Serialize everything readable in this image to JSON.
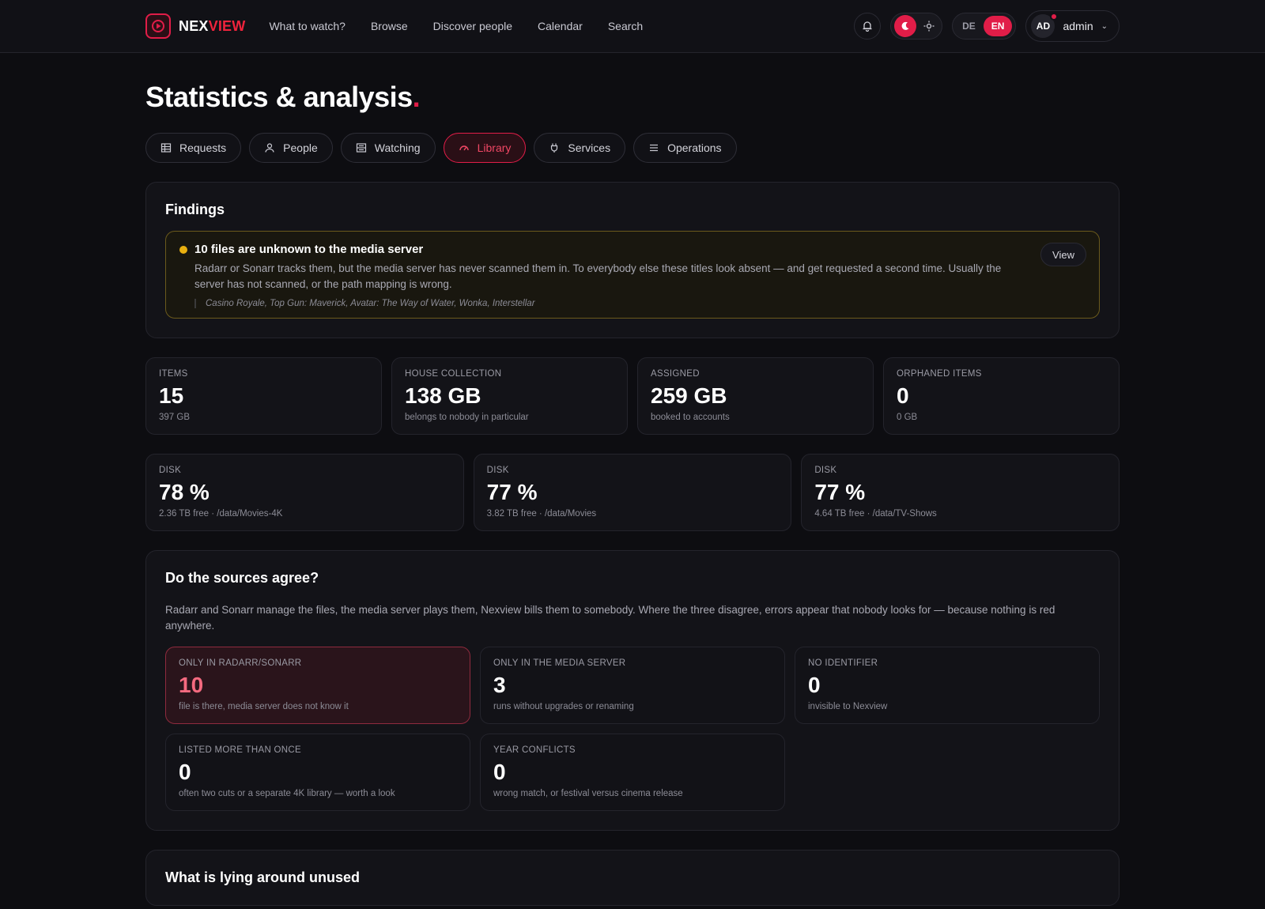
{
  "brand": {
    "part1": "NEX",
    "part2": "VIEW"
  },
  "nav": [
    "What to watch?",
    "Browse",
    "Discover people",
    "Calendar",
    "Search"
  ],
  "lang": {
    "de": "DE",
    "en": "EN"
  },
  "user": {
    "initials": "AD",
    "name": "admin"
  },
  "page": {
    "title": "Statistics & analysis",
    "title_dot": "."
  },
  "tabs": [
    {
      "label": "Requests",
      "icon": "table-icon"
    },
    {
      "label": "People",
      "icon": "person-icon"
    },
    {
      "label": "Watching",
      "icon": "list-icon"
    },
    {
      "label": "Library",
      "icon": "gauge-icon",
      "active": true
    },
    {
      "label": "Services",
      "icon": "plug-icon"
    },
    {
      "label": "Operations",
      "icon": "menu-icon"
    }
  ],
  "findings": {
    "heading": "Findings",
    "item": {
      "title": "10 files are unknown to the media server",
      "description": "Radarr or Sonarr tracks them, but the media server has never scanned them in. To everybody else these titles look absent — and get requested a second time. Usually the server has not scanned, or the path mapping is wrong.",
      "titles": "Casino Royale, Top Gun: Maverick, Avatar: The Way of Water, Wonka, Interstellar",
      "action": "View"
    }
  },
  "stats": [
    {
      "label": "ITEMS",
      "value": "15",
      "sub": "397 GB"
    },
    {
      "label": "HOUSE COLLECTION",
      "value": "138 GB",
      "sub": "belongs to nobody in particular"
    },
    {
      "label": "ASSIGNED",
      "value": "259 GB",
      "sub": "booked to accounts"
    },
    {
      "label": "ORPHANED ITEMS",
      "value": "0",
      "sub": "0 GB"
    }
  ],
  "disks": [
    {
      "label": "DISK",
      "value": "78 %",
      "sub": "2.36 TB free · /data/Movies-4K"
    },
    {
      "label": "DISK",
      "value": "77 %",
      "sub": "3.82 TB free · /data/Movies"
    },
    {
      "label": "DISK",
      "value": "77 %",
      "sub": "4.64 TB free · /data/TV-Shows"
    }
  ],
  "sources": {
    "heading": "Do the sources agree?",
    "intro": "Radarr and Sonarr manage the files, the media server plays them, Nexview bills them to somebody. Where the three disagree, errors appear that nobody looks for — because nothing is red anywhere.",
    "cards": [
      {
        "label": "ONLY IN RADARR/SONARR",
        "value": "10",
        "sub": "file is there, media server does not know it"
      },
      {
        "label": "ONLY IN THE MEDIA SERVER",
        "value": "3",
        "sub": "runs without upgrades or renaming"
      },
      {
        "label": "NO IDENTIFIER",
        "value": "0",
        "sub": "invisible to Nexview"
      },
      {
        "label": "LISTED MORE THAN ONCE",
        "value": "0",
        "sub": "often two cuts or a separate 4K library — worth a look"
      },
      {
        "label": "YEAR CONFLICTS",
        "value": "0",
        "sub": "wrong match, or festival versus cinema release"
      }
    ]
  },
  "unused": {
    "heading": "What is lying around unused"
  },
  "colors": {
    "accent": "#e11d48",
    "warning": "#e9b010",
    "background": "#0d0d11"
  }
}
